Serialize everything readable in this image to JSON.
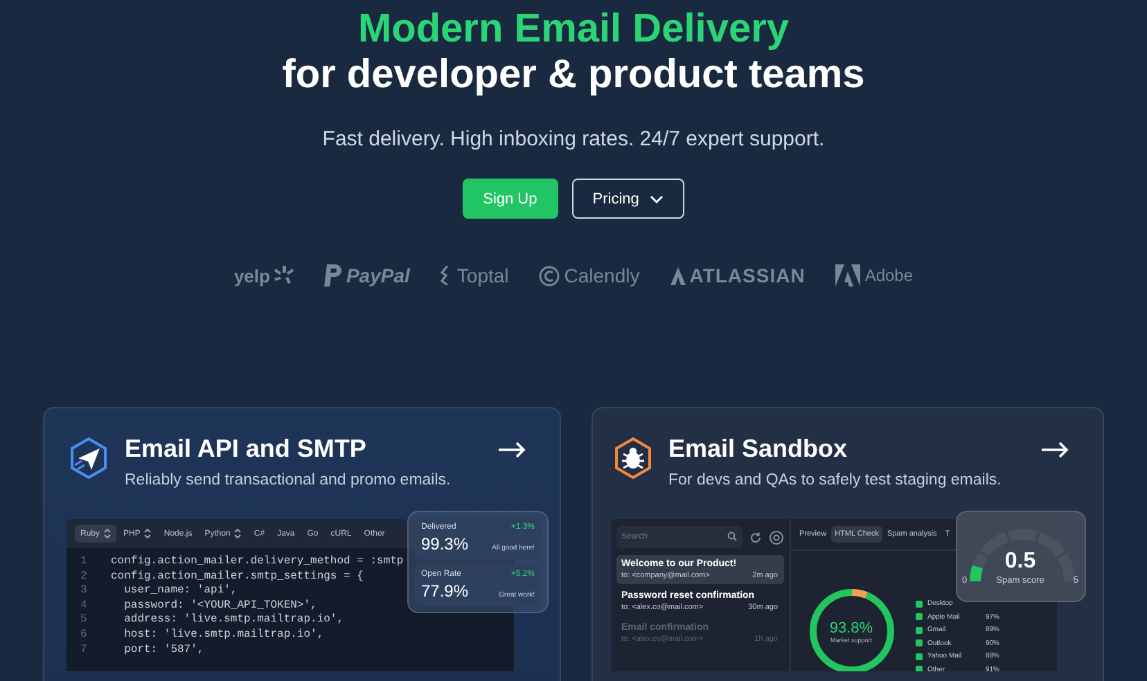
{
  "hero": {
    "headline": "Modern Email Delivery",
    "subheadline": "for developer & product teams",
    "tagline": "Fast delivery. High inboxing rates. 24/7 expert support.",
    "buttons": [
      {
        "label": "Sign Up",
        "kind": "primary"
      },
      {
        "label": "Pricing",
        "kind": "dropdown"
      }
    ]
  },
  "logos": [
    {
      "name": "yelp",
      "kind": "yelp"
    },
    {
      "name": "PayPal",
      "kind": "paypal"
    },
    {
      "name": "Toptal",
      "kind": "toptal"
    },
    {
      "name": "Calendly",
      "kind": "calendly"
    },
    {
      "name": "ATLASSIAN",
      "kind": "atlassian"
    },
    {
      "name": "Adobe",
      "kind": "adobe"
    }
  ],
  "products": [
    {
      "kind": "api",
      "title": "Email API and SMTP",
      "description": "Reliably send transactional and promo emails.",
      "code_tabs": [
        {
          "label": "Ruby",
          "selected": true,
          "dropdown": true
        },
        {
          "label": "PHP",
          "selected": false,
          "dropdown": true
        },
        {
          "label": "Node.js",
          "selected": false,
          "dropdown": false
        },
        {
          "label": "Python",
          "selected": false,
          "dropdown": true
        },
        {
          "label": "C#",
          "selected": false,
          "dropdown": false
        },
        {
          "label": "Java",
          "selected": false,
          "dropdown": false
        },
        {
          "label": "Go",
          "selected": false,
          "dropdown": false
        },
        {
          "label": "cURL",
          "selected": false,
          "dropdown": false
        },
        {
          "label": "Other",
          "selected": false,
          "dropdown": false
        }
      ],
      "code_lines": [
        {
          "number": "1",
          "text": "config.action_mailer.delivery_method = :smtp"
        },
        {
          "number": "2",
          "text": "config.action_mailer.smtp_settings = {"
        },
        {
          "number": "3",
          "text": "  user_name: 'api',"
        },
        {
          "number": "4",
          "text": "  password: '<YOUR_API_TOKEN>',"
        },
        {
          "number": "5",
          "text": "  address: 'live.smtp.mailtrap.io',"
        },
        {
          "number": "6",
          "text": "  host: 'live.smtp.mailtrap.io',"
        },
        {
          "number": "7",
          "text": "  port: '587',"
        }
      ],
      "stats": [
        {
          "label": "Delivered",
          "change": "+1.3%",
          "value": "99.3%",
          "note": "All good here!"
        },
        {
          "label": "Open Rate",
          "change": "+5.2%",
          "value": "77.9%",
          "note": "Great work!"
        }
      ]
    },
    {
      "kind": "sandbox",
      "title": "Email Sandbox",
      "description": "For devs and QAs to safely test staging emails.",
      "search": {
        "placeholder": "Search"
      },
      "tabs": [
        {
          "label": "Preview",
          "selected": false
        },
        {
          "label": "HTML Check",
          "selected": true
        },
        {
          "label": "Spam analysis",
          "selected": false
        },
        {
          "label": "T",
          "selected": false
        }
      ],
      "emails": [
        {
          "subject": "Welcome to our Product!",
          "to": "to: <company@mail.com>",
          "time": "2m ago",
          "selected": true,
          "faded": false
        },
        {
          "subject": "Password reset confirmation",
          "to": "to: <alex.co@mail.com>",
          "time": "30m ago",
          "selected": false,
          "faded": false
        },
        {
          "subject": "Email confirmation",
          "to": "to: <alex.co@mail.com>",
          "time": "1h ago",
          "selected": false,
          "faded": true
        }
      ],
      "donut": {
        "value": "93.8%",
        "label": "Market support",
        "level": 0.938
      },
      "legend": {
        "label": "Desktop",
        "checked": true
      },
      "clients": [
        {
          "label": "Apple Mail",
          "value": "97%",
          "checked": true
        },
        {
          "label": "Gmail",
          "value": "89%",
          "checked": true
        },
        {
          "label": "Outlook",
          "value": "90%",
          "checked": true
        },
        {
          "label": "Yahoo Mail",
          "value": "88%",
          "checked": true
        },
        {
          "label": "Other",
          "value": "91%",
          "checked": true
        }
      ],
      "spam_score": {
        "value": "0.5",
        "label": "Spam score",
        "min": "0",
        "max": "5",
        "level": 0.1
      }
    }
  ]
}
